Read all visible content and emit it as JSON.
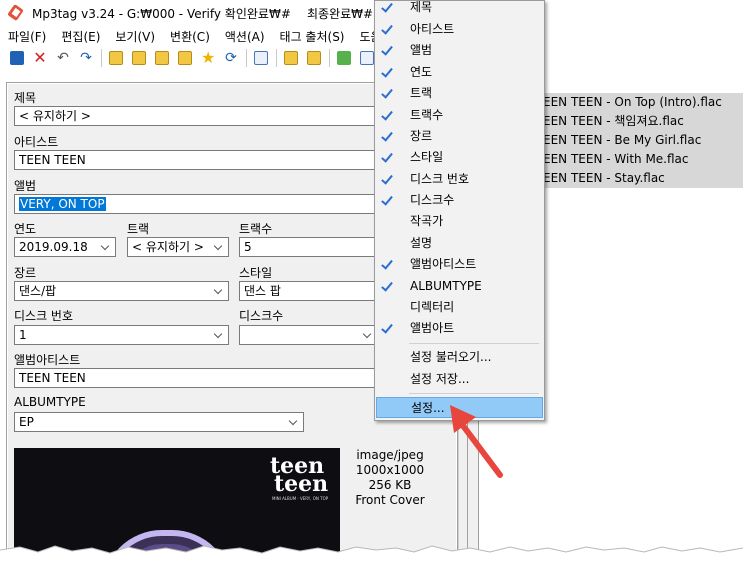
{
  "window": {
    "title": "Mp3tag v3.24  -  G:₩000 - Verify 확인완료₩#",
    "title_right": "최종완료₩##"
  },
  "menubar": {
    "items": [
      "파일(F)",
      "편집(E)",
      "보기(V)",
      "변환(C)",
      "액션(A)",
      "태그 출처(S)",
      "도움말"
    ]
  },
  "toolbar": {
    "icons": [
      "save-icon",
      "delete-icon",
      "undo-icon",
      "redo-icon",
      "folder-open-icon",
      "add-folder-icon",
      "playlist-icon",
      "star-icon",
      "refresh-icon",
      "tag-icon",
      "import-icon",
      "globe-icon",
      "options-icon"
    ]
  },
  "tag_panel": {
    "title_label": "제목",
    "title_value": "< 유지하기 >",
    "artist_label": "아티스트",
    "artist_value": "TEEN TEEN",
    "album_label": "앨범",
    "album_value": "VERY, ON TOP",
    "year_label": "연도",
    "year_value": "2019.09.18",
    "track_label": "트랙",
    "track_value": "< 유지하기 >",
    "tracks_label": "트랙수",
    "tracks_value": "5",
    "genre_label": "장르",
    "genre_value": "댄스/팝",
    "style_label": "스타일",
    "style_value": "댄스 팝",
    "disc_label": "디스크 번호",
    "disc_value": "1",
    "discs_label": "디스크수",
    "discs_value": "",
    "albumartist_label": "앨범아티스트",
    "albumartist_value": "TEEN TEEN",
    "albumtype_label": "ALBUMTYPE",
    "albumtype_value": "EP"
  },
  "cover": {
    "logo_line1": "teen",
    "logo_line2": "teen",
    "logo_sub": "MINI ALBUM · VERY, ON TOP",
    "mime": "image/jpeg",
    "dimensions": "1000x1000",
    "size": "256 KB",
    "type": "Front Cover"
  },
  "file_list": [
    "EEN TEEN - On Top (Intro).flac",
    "EEN TEEN - 책임져요.flac",
    "EEN TEEN - Be My Girl.flac",
    "EEN TEEN - With Me.flac",
    "EEN TEEN - Stay.flac"
  ],
  "context_menu": {
    "items": [
      {
        "label": "제목",
        "checked": true
      },
      {
        "label": "아티스트",
        "checked": true
      },
      {
        "label": "앨범",
        "checked": true
      },
      {
        "label": "연도",
        "checked": true
      },
      {
        "label": "트랙",
        "checked": true
      },
      {
        "label": "트랙수",
        "checked": true
      },
      {
        "label": "장르",
        "checked": true
      },
      {
        "label": "스타일",
        "checked": true
      },
      {
        "label": "디스크 번호",
        "checked": true
      },
      {
        "label": "디스크수",
        "checked": true
      },
      {
        "label": "작곡가",
        "checked": false
      },
      {
        "label": "설명",
        "checked": false
      },
      {
        "label": "앨범아티스트",
        "checked": true
      },
      {
        "label": "ALBUMTYPE",
        "checked": true
      },
      {
        "label": "디렉터리",
        "checked": false
      },
      {
        "label": "앨범아트",
        "checked": true
      }
    ],
    "load_settings": "설정 불러오기...",
    "save_settings": "설정 저장...",
    "settings": "설정..."
  },
  "colors": {
    "selection": "#0078d7",
    "menu_highlight": "#91c9f7",
    "check": "#2a6ed0",
    "annotation_arrow": "#e8453c"
  }
}
